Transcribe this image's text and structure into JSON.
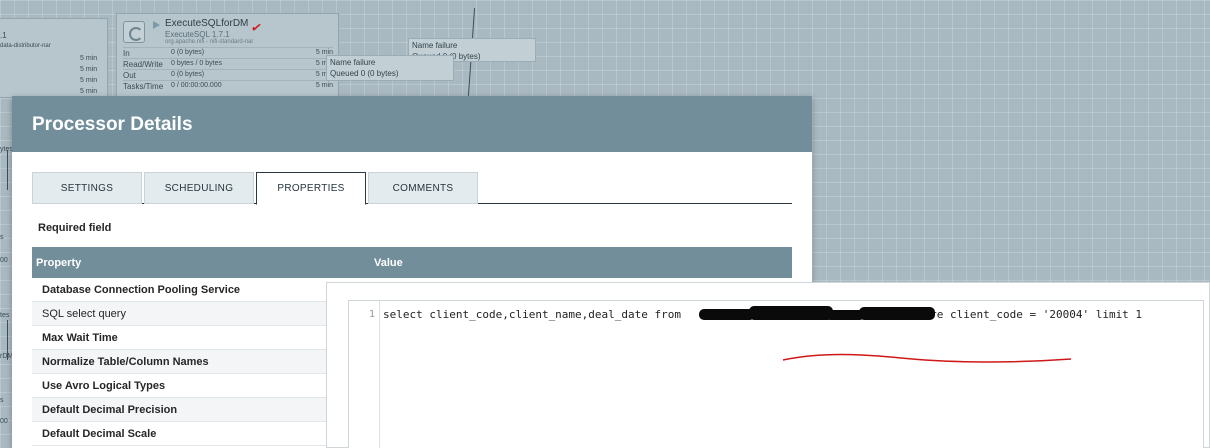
{
  "canvas": {
    "main_processor": {
      "name": "ExecuteSQLforDM",
      "type": "ExecuteSQL 1.7.1",
      "bundle": "org.apache.nifi - nifi-standard-nar",
      "stats": [
        {
          "label": "In",
          "value": "0 (0 bytes)",
          "time": "5 min"
        },
        {
          "label": "Read/Write",
          "value": "0 bytes / 0 bytes",
          "time": "5 min"
        },
        {
          "label": "Out",
          "value": "0 (0 bytes)",
          "time": "5 min"
        },
        {
          "label": "Tasks/Time",
          "value": "0 / 00:00:00.000",
          "time": "5 min"
        }
      ]
    },
    "left_processor": {
      "title": ".1",
      "bundle": "data-distributor-nar",
      "times": [
        "5 min",
        "5 min",
        "5 min",
        "5 min"
      ]
    },
    "connections": [
      {
        "name_label": "Name",
        "name": "failure",
        "queued_label": "Queued",
        "queued": "0 (0 bytes)"
      },
      {
        "name_label": "Name",
        "name": "failure",
        "queued_label": "Queued",
        "queued": "0 (0 bytes)"
      }
    ],
    "left_fragments": [
      "ytes)",
      "s",
      "00",
      "tes",
      "rDM",
      "s",
      "00"
    ]
  },
  "dialog": {
    "title": "Processor Details",
    "tabs": [
      {
        "label": "SETTINGS",
        "active": false
      },
      {
        "label": "SCHEDULING",
        "active": false
      },
      {
        "label": "PROPERTIES",
        "active": true
      },
      {
        "label": "COMMENTS",
        "active": false
      }
    ],
    "required_field": "Required field",
    "table": {
      "headers": {
        "property": "Property",
        "value": "Value"
      },
      "rows": [
        {
          "name": "Database Connection Pooling Service",
          "required": true
        },
        {
          "name": "SQL select query",
          "required": false
        },
        {
          "name": "Max Wait Time",
          "required": true
        },
        {
          "name": "Normalize Table/Column Names",
          "required": true
        },
        {
          "name": "Use Avro Logical Types",
          "required": true
        },
        {
          "name": "Default Decimal Precision",
          "required": true
        },
        {
          "name": "Default Decimal Scale",
          "required": true
        }
      ]
    }
  },
  "editor": {
    "line_number": "1",
    "code_before": "select client_code,client_name,deal_date from ",
    "code_after": " where client_code = '20004' limit 1"
  },
  "colors": {
    "header": "#728e9b",
    "annotation_red": "#d01818"
  }
}
